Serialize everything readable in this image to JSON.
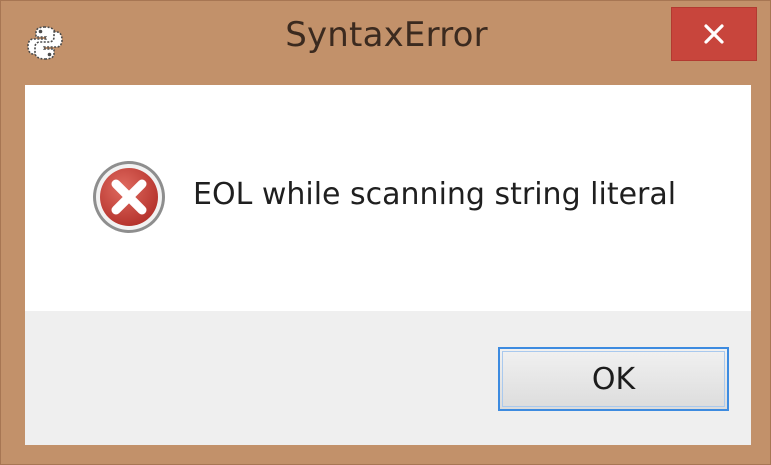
{
  "window": {
    "title": "SyntaxError",
    "app_icon": "python-icon",
    "close_icon": "close-icon",
    "accent_color": "#c2916a",
    "close_button_color": "#c8453c"
  },
  "dialog": {
    "status_icon": "error-icon",
    "message": "EOL while scanning string literal",
    "ok_label": "OK"
  }
}
